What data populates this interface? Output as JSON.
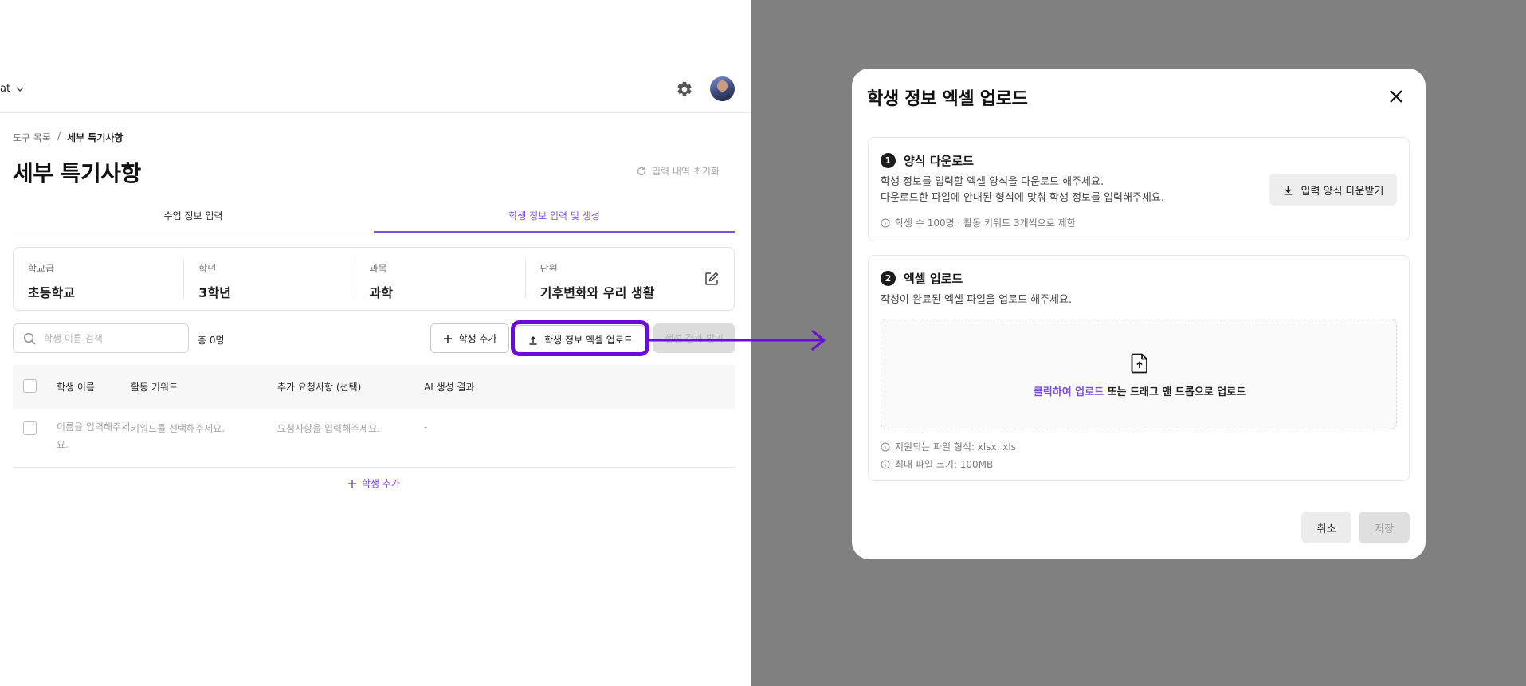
{
  "app": {
    "workspace_label": "at",
    "breadcrumb": {
      "parent": "도구 목록",
      "separator": "/",
      "current": "세부 특기사항"
    },
    "page_title": "세부 특기사항",
    "reset_label": "입력 내역 초기화",
    "tabs": [
      {
        "label": "수업 정보 입력",
        "active": false
      },
      {
        "label": "학생 정보 입력 및 생성",
        "active": true
      }
    ],
    "info": {
      "school_level": {
        "key": "학교급",
        "value": "초등학교"
      },
      "grade": {
        "key": "학년",
        "value": "3학년"
      },
      "subject": {
        "key": "과목",
        "value": "과학"
      },
      "unit": {
        "key": "단원",
        "value": "기후변화와 우리 생활"
      }
    },
    "search": {
      "placeholder": "학생 이름 검색",
      "value": ""
    },
    "total_count": "총 0명",
    "buttons": {
      "add_student": "학생 추가",
      "excel_upload": "학생 정보 엑셀 업로드",
      "generate": "생성 결과 받기"
    },
    "table": {
      "headers": [
        "학생 이름",
        "활동 키워드",
        "추가 요청사항 (선택)",
        "AI 생성 결과"
      ],
      "rows": [
        {
          "name": "이름을 입력해주세요.",
          "keywords": "키워드를 선택해주세요.",
          "request": "요청사항을 입력해주세요.",
          "result": "-"
        }
      ]
    },
    "add_row_label": "학생 추가",
    "accent_color": "#7b4fe0",
    "highlight_color": "#6a0cdc"
  },
  "modal": {
    "title": "학생 정보 엑셀 업로드",
    "step1": {
      "number": "1",
      "title": "양식 다운로드",
      "desc_line1": "학생 정보를 입력할 엑셀 양식을 다운로드 해주세요.",
      "desc_line2": "다운로드한 파일에 안내된 형식에 맞춰 학생 정보를 입력해주세요.",
      "note": "학생 수 100명 · 활동 키워드 3개씩으로 제한",
      "download_button": "입력 양식 다운받기"
    },
    "step2": {
      "number": "2",
      "title": "엑셀 업로드",
      "desc": "작성이 완료된 엑셀 파일을 업로드 해주세요.",
      "dropzone_link": "클릭하여 업로드",
      "dropzone_text": " 또는 드래그 앤 드롭으로 업로드",
      "note_formats": "지원되는 파일 형식: xlsx, xls",
      "note_size": "최대 파일 크기: 100MB"
    },
    "cancel_label": "취소",
    "save_label": "저장"
  }
}
